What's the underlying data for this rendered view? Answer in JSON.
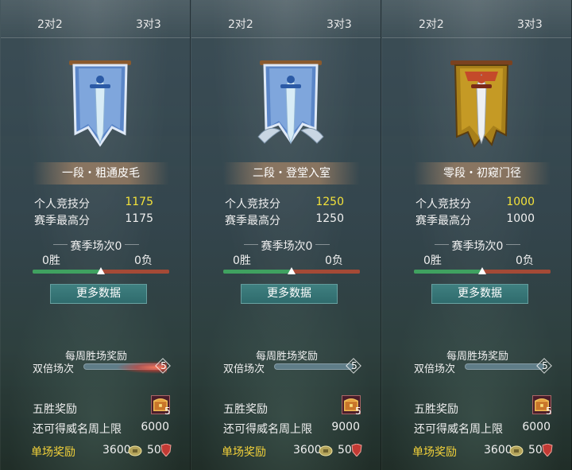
{
  "panels": [
    {
      "tabs": [
        "2对2",
        "3对3"
      ],
      "rank": "一段・粗通皮毛",
      "banner_style": "blue",
      "personal_score_label": "个人竞技分",
      "personal_score": "1175",
      "season_high_label": "赛季最高分",
      "season_high": "1175",
      "season_matches": "赛季场次0",
      "wins": "0胜",
      "losses": "0负",
      "more_data": "更多数据",
      "weekly_title": "每周胜场奖励",
      "double_label": "双倍场次",
      "double_count": "5",
      "double_fx": true,
      "five_win_label": "五胜奖励",
      "chest_count": "5",
      "cap_label": "还可得威名周上限",
      "cap_value": "6000",
      "single_label": "单场奖励",
      "single_value1": "3600",
      "single_value2": "50"
    },
    {
      "tabs": [
        "2对2",
        "3对3"
      ],
      "rank": "二段・登堂入室",
      "banner_style": "blue-wings",
      "personal_score_label": "个人竞技分",
      "personal_score": "1250",
      "season_high_label": "赛季最高分",
      "season_high": "1250",
      "season_matches": "赛季场次0",
      "wins": "0胜",
      "losses": "0负",
      "more_data": "更多数据",
      "weekly_title": "每周胜场奖励",
      "double_label": "双倍场次",
      "double_count": "5",
      "double_fx": false,
      "five_win_label": "五胜奖励",
      "chest_count": "5",
      "cap_label": "还可得威名周上限",
      "cap_value": "9000",
      "single_label": "单场奖励",
      "single_value1": "3600",
      "single_value2": "50"
    },
    {
      "tabs": [
        "2对2",
        "3对3"
      ],
      "rank": "零段・初窥门径",
      "banner_style": "gold",
      "personal_score_label": "个人竞技分",
      "personal_score": "1000",
      "season_high_label": "赛季最高分",
      "season_high": "1000",
      "season_matches": "赛季场次0",
      "wins": "0胜",
      "losses": "0负",
      "more_data": "更多数据",
      "weekly_title": "每周胜场奖励",
      "double_label": "双倍场次",
      "double_count": "5",
      "double_fx": false,
      "five_win_label": "五胜奖励",
      "chest_count": "5",
      "cap_label": "还可得威名周上限",
      "cap_value": "6000",
      "single_label": "单场奖励",
      "single_value1": "3600",
      "single_value2": "50"
    }
  ],
  "colors": {
    "highlight": "#f3e23a",
    "single_reward": "#f3d23a",
    "win_bar": "#3fa160",
    "loss_bar": "#a44a36",
    "button": "#2f6b6d"
  },
  "icons": {
    "banner": "sword-banner-icon",
    "chest": "treasure-chest-icon",
    "coin": "coin-icon",
    "shield": "shield-icon"
  }
}
